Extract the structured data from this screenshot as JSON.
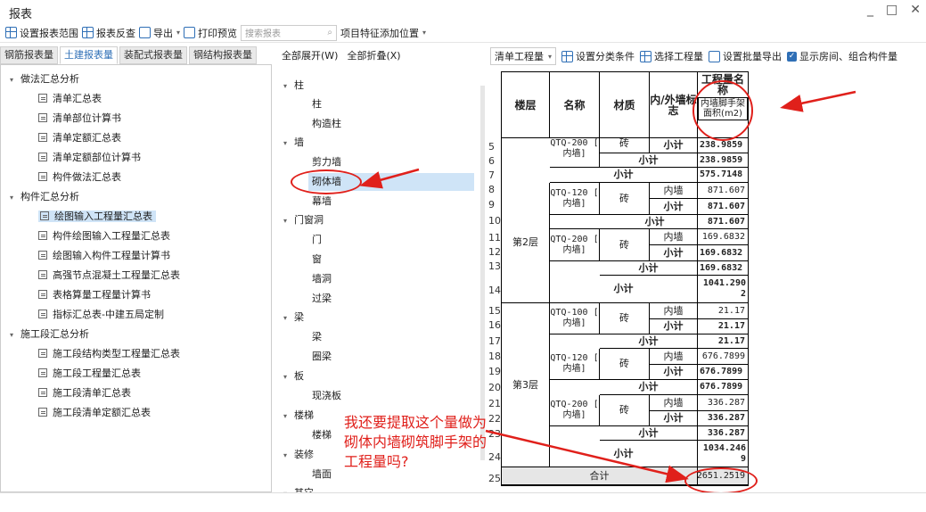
{
  "window": {
    "title": "报表",
    "controls": [
      "_",
      "□",
      "✕"
    ]
  },
  "toolbar": {
    "set_range": "设置报表范围",
    "cross_check": "报表反查",
    "export": "导出",
    "print_preview": "打印预览",
    "search_placeholder": "搜索报表",
    "feature_position": "项目特征添加位置"
  },
  "tabs": [
    "钢筋报表量",
    "土建报表量",
    "装配式报表量",
    "钢结构报表量"
  ],
  "active_tab": "土建报表量",
  "tree": {
    "g1": "做法汇总分析",
    "g1_items": [
      "清单汇总表",
      "清单部位计算书",
      "清单定额汇总表",
      "清单定额部位计算书",
      "构件做法汇总表"
    ],
    "g2": "构件汇总分析",
    "g2_items": [
      "绘图输入工程量汇总表",
      "构件绘图输入工程量汇总表",
      "绘图输入构件工程量计算书",
      "高强节点混凝土工程量汇总表",
      "表格算量工程量计算书",
      "指标汇总表-中建五局定制"
    ],
    "g3": "施工段汇总分析",
    "g3_items": [
      "施工段结构类型工程量汇总表",
      "施工段工程量汇总表",
      "施工段清单汇总表",
      "施工段清单定额汇总表"
    ]
  },
  "mid": {
    "expand_all": "全部展开(W)",
    "collapse_all": "全部折叠(X)",
    "c_zhu": "柱",
    "zhu_items": [
      "柱",
      "构造柱"
    ],
    "c_qiang": "墙",
    "qiang_items": [
      "剪力墙",
      "砌体墙",
      "幕墙"
    ],
    "c_men": "门窗洞",
    "men_items": [
      "门",
      "窗",
      "墙洞",
      "过梁"
    ],
    "c_liang": "梁",
    "liang_items": [
      "梁",
      "圈梁"
    ],
    "c_ban": "板",
    "ban_items": [
      "现浇板"
    ],
    "c_lt": "楼梯",
    "lt_items": [
      "楼梯"
    ],
    "c_zx": "装修",
    "zx_items": [
      "墙面"
    ],
    "c_qt": "其它"
  },
  "right_toolbar": {
    "qty_type": "清单工程量",
    "set_category": "设置分类条件",
    "select_qty": "选择工程量",
    "batch_export": "设置批量导出",
    "show_room": "显示房间、组合构件量"
  },
  "table": {
    "h_floor": "楼层",
    "h_name": "名称",
    "h_material": "材质",
    "h_inout": "内/外墙标志",
    "h_qty": "工程量名称",
    "h_qty_sub": "内墙脚手架面积(m2)",
    "row_nums": [
      "5",
      "6",
      "7",
      "8",
      "9",
      "10",
      "11",
      "12",
      "13",
      "14",
      "15",
      "16",
      "17",
      "18",
      "19",
      "20",
      "21",
      "22",
      "23",
      "24",
      "25"
    ],
    "name_qtq200_frag": "QTQ-200 [ 内墙]",
    "mat_frag": "砖",
    "subtotal": "小计",
    "total": "合计",
    "floor2": "第2层",
    "floor3": "第3层",
    "n_qtq120": "QTQ-120 [ 内墙]",
    "n_qtq200": "QTQ-200 [ 内墙]",
    "n_qtq100": "QTQ-100 [ 内墙]",
    "m_brick": "砖",
    "inner": "内墙",
    "v5": "238.9859",
    "v6": "238.9859",
    "v7": "575.7148",
    "v8": "871.607",
    "v9": "871.607",
    "v10": "871.607",
    "v11": "169.6832",
    "v12": "169.6832",
    "v13": "169.6832",
    "v14": "1041.290\n2",
    "v15": "21.17",
    "v16": "21.17",
    "v17": "21.17",
    "v18": "676.7899",
    "v19": "676.7899",
    "v20": "676.7899",
    "v21": "336.287",
    "v22": "336.287",
    "v23": "336.287",
    "v24": "1034.246\n9",
    "v25": "2651.2519"
  },
  "annotation": "我还要提取这个量做为砌体内墙砌筑脚手架的工程量吗?",
  "colors": {
    "accent": "#2f6fb6",
    "annotation": "#e0201b",
    "selected": "#cfe4f7"
  }
}
